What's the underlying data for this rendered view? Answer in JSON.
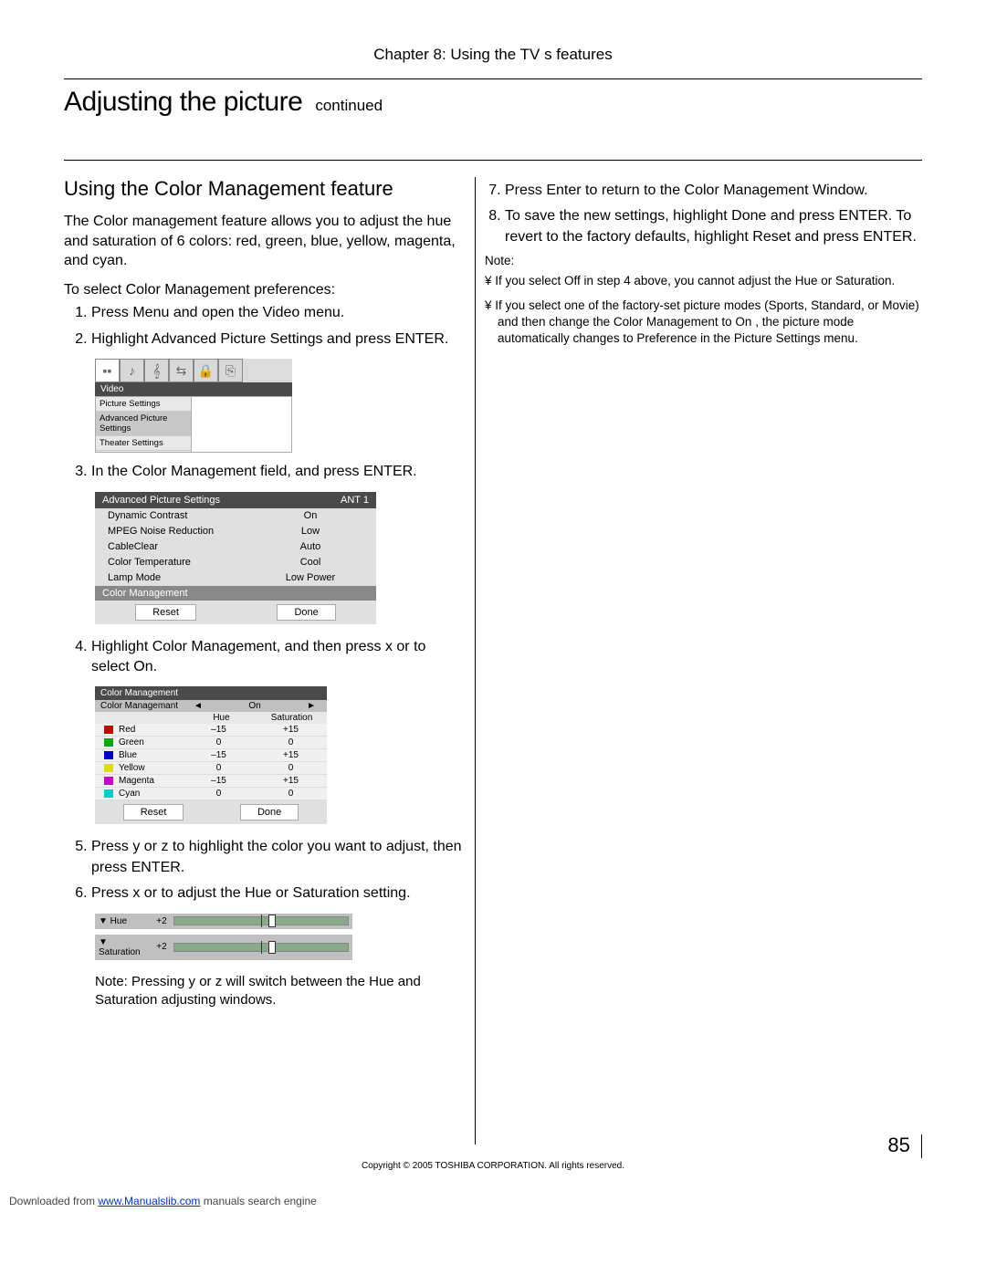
{
  "chapter_header": "Chapter 8: Using the TV s features",
  "section_title": "Adjusting the picture",
  "continued": "continued",
  "feature_heading": "Using the Color Management feature",
  "intro_paragraph": "The Color management feature allows you to adjust the hue and saturation of 6 colors: red, green, blue, yellow, magenta, and cyan.",
  "to_select": "To select Color Management preferences:",
  "steps_left": [
    "Press Menu and open the Video menu.",
    "Highlight Advanced Picture Settings and press ENTER."
  ],
  "step3": "In the Color Management field, and press ENTER.",
  "step4": "Highlight Color Management, and then press x or  to select On.",
  "step5": "Press y or z to highlight the color you want to adjust, then press ENTER.",
  "step6": "Press x or  to adjust the Hue or Saturation setting.",
  "step_note": "Note: Pressing y or z will switch between the Hue and Saturation adjusting windows.",
  "right_steps": {
    "s7": "Press Enter to return to the Color Management Window.",
    "s8": "To save the new settings, highlight Done and press ENTER. To revert to the factory defaults, highlight Reset and press ENTER."
  },
  "right_note_label": "Note:",
  "right_notes": [
    "If you select Off in step 4 above, you cannot adjust the Hue or Saturation.",
    "If you select one of the factory-set picture modes (Sports, Standard, or Movie) and then change the Color Management to  On , the picture mode automatically changes to Preference in the Picture Settings menu."
  ],
  "video_menu": {
    "title": "Video",
    "items": [
      "Picture Settings",
      "Advanced Picture Settings",
      "Theater Settings"
    ]
  },
  "adv_table": {
    "title": "Advanced Picture Settings",
    "ant": "ANT 1",
    "rows": [
      {
        "label": "Dynamic Contrast",
        "value": "On"
      },
      {
        "label": "MPEG Noise Reduction",
        "value": "Low"
      },
      {
        "label": "CableClear",
        "value": "Auto"
      },
      {
        "label": "Color Temperature",
        "value": "Cool"
      },
      {
        "label": "Lamp Mode",
        "value": "Low Power"
      }
    ],
    "cm_row": "Color Management",
    "reset": "Reset",
    "done": "Done"
  },
  "cm_table": {
    "title": "Color Management",
    "mode_label": "Color Managemant",
    "mode_value": "On",
    "col_hue": "Hue",
    "col_sat": "Saturation",
    "rows": [
      {
        "color": "#c00",
        "name": "Red",
        "hue": "–15",
        "sat": "+15"
      },
      {
        "color": "#0a0",
        "name": "Green",
        "hue": "0",
        "sat": "0"
      },
      {
        "color": "#00c",
        "name": "Blue",
        "hue": "–15",
        "sat": "+15"
      },
      {
        "color": "#dd0",
        "name": "Yellow",
        "hue": "0",
        "sat": "0"
      },
      {
        "color": "#c0c",
        "name": "Magenta",
        "hue": "–15",
        "sat": "+15"
      },
      {
        "color": "#0cc",
        "name": "Cyan",
        "hue": "0",
        "sat": "0"
      }
    ],
    "reset": "Reset",
    "done": "Done"
  },
  "sliders": {
    "hue_label": "▼ Hue",
    "hue_val": "+2",
    "sat_label": "▼ Saturation",
    "sat_val": "+2"
  },
  "copyright": "Copyright © 2005 TOSHIBA CORPORATION. All rights reserved.",
  "page_number": "85",
  "download": {
    "prefix": "Downloaded from ",
    "link_text": "www.Manualslib.com",
    "suffix": " manuals search engine"
  }
}
